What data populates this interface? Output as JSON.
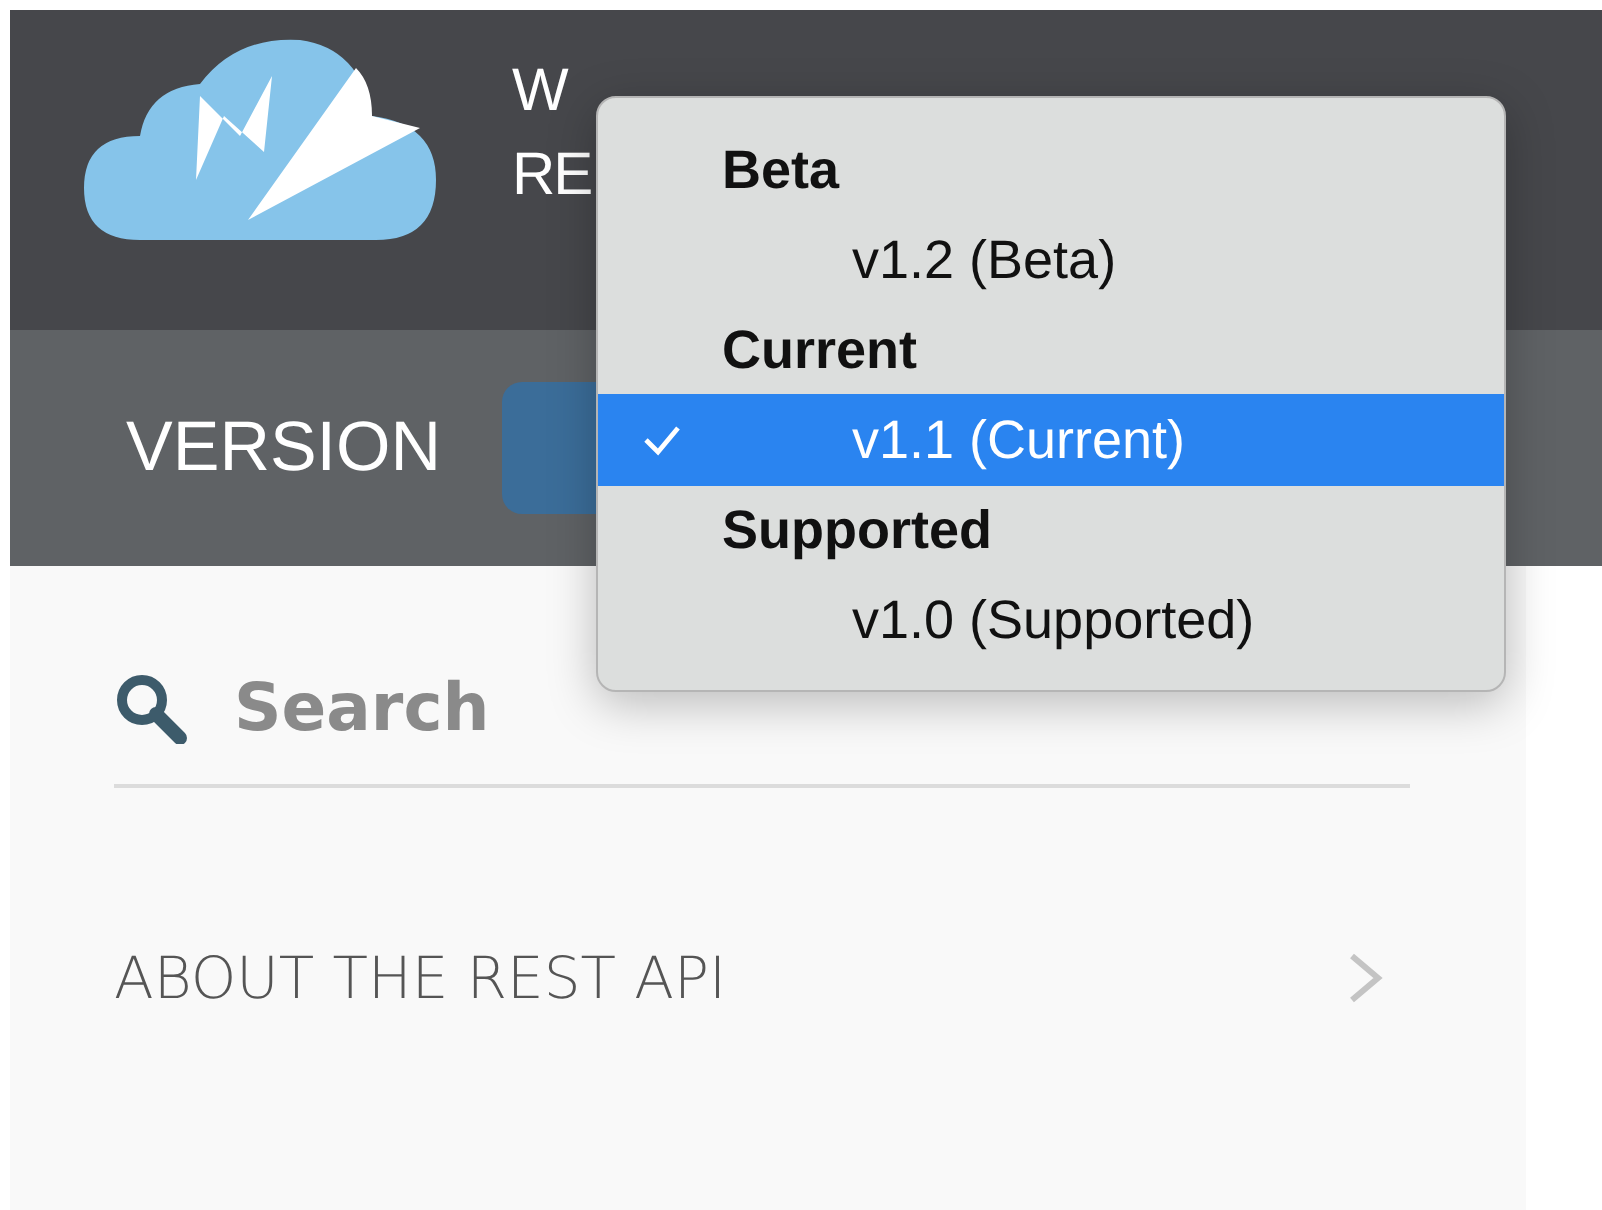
{
  "header": {
    "title_lines": [
      "W",
      "RE"
    ]
  },
  "version_bar": {
    "label": "VERSION"
  },
  "version_menu": {
    "groups": [
      {
        "label": "Beta",
        "items": [
          {
            "label": "v1.2 (Beta)",
            "selected": false
          }
        ]
      },
      {
        "label": "Current",
        "items": [
          {
            "label": "v1.1 (Current)",
            "selected": true
          }
        ]
      },
      {
        "label": "Supported",
        "items": [
          {
            "label": "v1.0 (Supported)",
            "selected": false
          }
        ]
      }
    ]
  },
  "search": {
    "placeholder": "Search"
  },
  "nav_items": [
    {
      "label": "ABOUT THE REST API"
    }
  ]
}
